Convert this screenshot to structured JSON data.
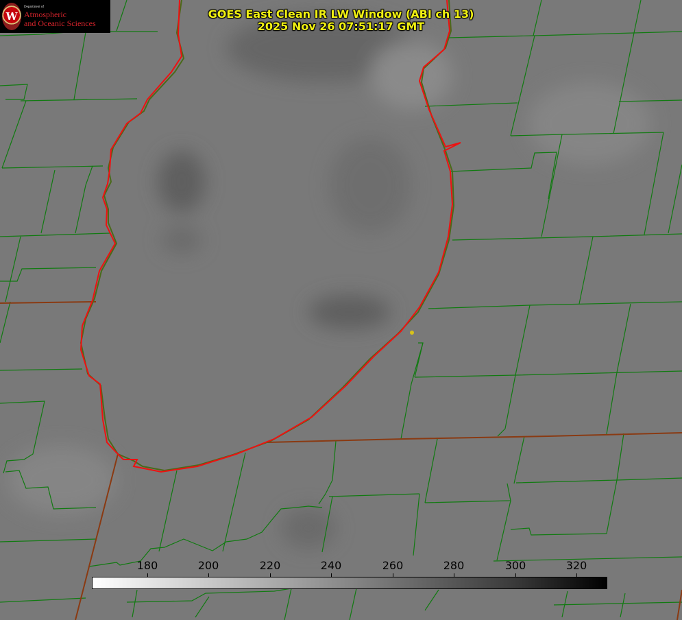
{
  "title": {
    "line1": "GOES East Clean IR LW Window (ABI ch 13)",
    "line2": "2025 Nov 26 07:51:17 GMT"
  },
  "logo": {
    "department": "Department of",
    "line1": "Atmospheric",
    "line2": "and Oceanic Sciences",
    "seal_letter": "W"
  },
  "colorbar": {
    "ticks": [
      "180",
      "200",
      "220",
      "240",
      "260",
      "280",
      "300",
      "320"
    ]
  },
  "colors": {
    "county_lines": "#117a11",
    "state_lines": "#8a3a12",
    "coastline": "#ee1111",
    "title_text": "#f1f112",
    "site_marker": "#d7c21a"
  }
}
